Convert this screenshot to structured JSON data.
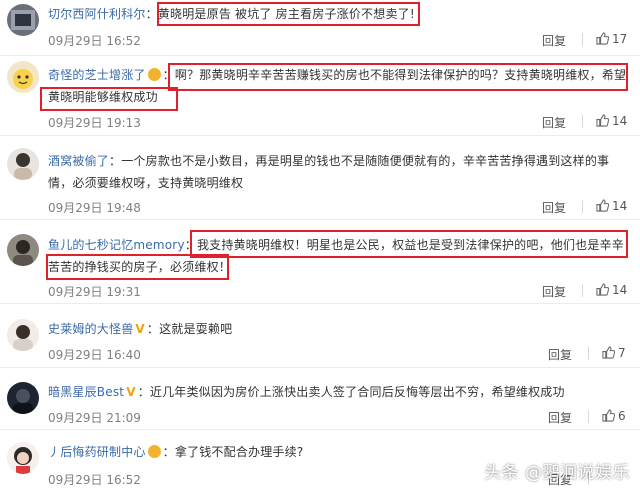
{
  "comments": [
    {
      "user": "切尔西阿什利科尔",
      "separator": "：",
      "text": "黄晓明是原告 被坑了 房主看房子涨价不想卖了!",
      "time": "09月29日 16:52",
      "reply": "回复",
      "likes": "17"
    },
    {
      "user": "奇怪的芝士增涨了",
      "separator": "：",
      "text": "啊？那黄晓明辛辛苦苦赚钱买的房也不能得到法律保护的吗？支持黄晓明维权，希望黄晓明能够维权成功",
      "time": "09月29日 19:13",
      "reply": "回复",
      "likes": "14"
    },
    {
      "user": "酒窝被偷了",
      "separator": "：",
      "text": "一个房款也不是小数目，再是明星的钱也不是随随便便就有的，辛辛苦苦挣得遇到这样的事情，必须要维权呀，支持黄晓明维权",
      "time": "09月29日 19:48",
      "reply": "回复",
      "likes": "14"
    },
    {
      "user": "鱼儿的七秒记忆memory",
      "separator": "：",
      "text": "我支持黄晓明维权！明星也是公民，权益也是受到法律保护的吧，他们也是辛辛苦苦的挣钱买的房子，必须维权！",
      "time": "09月29日 19:31",
      "reply": "回复",
      "likes": "14"
    },
    {
      "user": "史莱姆的大怪兽",
      "separator": "：",
      "text": "这就是耍赖吧",
      "time": "09月29日 16:40",
      "reply": "回复",
      "likes": "7"
    },
    {
      "user": "暗黑星辰Best",
      "separator": "：",
      "text": "近几年类似因为房价上涨快出卖人签了合同后反悔等层出不穷，希望维权成功",
      "time": "09月29日 21:09",
      "reply": "回复",
      "likes": "6"
    },
    {
      "user": "丿后悔药研制中心",
      "separator": "：",
      "text": "拿了钱不配合办理手续?",
      "time": "09月29日 16:52",
      "reply": "回复",
      "likes": ""
    }
  ],
  "watermark": "头条 @鹦洄说娱乐",
  "colors": {
    "username": "#3a6aaa",
    "highlight": "#e0212b",
    "badge": "#f3b22e"
  }
}
